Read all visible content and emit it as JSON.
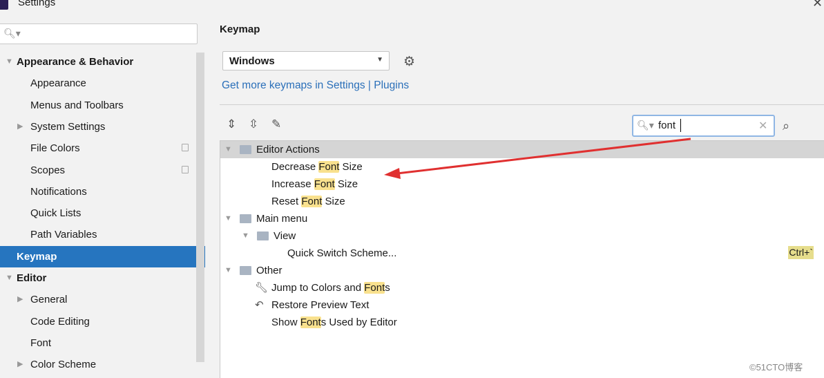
{
  "window": {
    "title": "Settings"
  },
  "sidebar": {
    "search_placeholder": "",
    "items": [
      {
        "label": "Appearance & Behavior",
        "level": 0,
        "expanded": true
      },
      {
        "label": "Appearance",
        "level": 1
      },
      {
        "label": "Menus and Toolbars",
        "level": 1
      },
      {
        "label": "System Settings",
        "level": 1,
        "expandable": true
      },
      {
        "label": "File Colors",
        "level": 1,
        "project_icon": true
      },
      {
        "label": "Scopes",
        "level": 1,
        "project_icon": true
      },
      {
        "label": "Notifications",
        "level": 1
      },
      {
        "label": "Quick Lists",
        "level": 1
      },
      {
        "label": "Path Variables",
        "level": 1
      },
      {
        "label": "Keymap",
        "level": 0,
        "selected": true
      },
      {
        "label": "Editor",
        "level": 0,
        "expanded": true
      },
      {
        "label": "General",
        "level": 1,
        "expandable": true
      },
      {
        "label": "Code Editing",
        "level": 1
      },
      {
        "label": "Font",
        "level": 1
      },
      {
        "label": "Color Scheme",
        "level": 1,
        "expandable": true
      }
    ]
  },
  "main": {
    "heading": "Keymap",
    "keymap_select": "Windows",
    "link": "Get more keymaps in Settings | Plugins",
    "search_value": "font",
    "tree": [
      {
        "pre": "",
        "hl": "",
        "post": "Editor Actions",
        "group": true
      },
      {
        "pre": "Decrease ",
        "hl": "Font",
        "post": " Size"
      },
      {
        "pre": "Increase ",
        "hl": "Font",
        "post": " Size"
      },
      {
        "pre": "Reset ",
        "hl": "Font",
        "post": " Size"
      },
      {
        "pre": "",
        "hl": "",
        "post": "Main menu"
      },
      {
        "pre": "",
        "hl": "",
        "post": "View"
      },
      {
        "pre": "",
        "hl": "",
        "post": "Quick Switch Scheme...",
        "shortcut": "Ctrl+`"
      },
      {
        "pre": "",
        "hl": "",
        "post": "Other"
      },
      {
        "pre": "Jump to Colors and ",
        "hl": "Font",
        "post": "s"
      },
      {
        "pre": "",
        "hl": "",
        "post": "Restore Preview Text"
      },
      {
        "pre": "Show ",
        "hl": "Font",
        "post": "s Used by Editor"
      }
    ]
  },
  "colors": {
    "selection": "#2675bf",
    "highlight": "#f9e18e",
    "link": "#2a6fb9",
    "annotation_arrow": "#e03030"
  },
  "watermark": "©51CTO博客"
}
